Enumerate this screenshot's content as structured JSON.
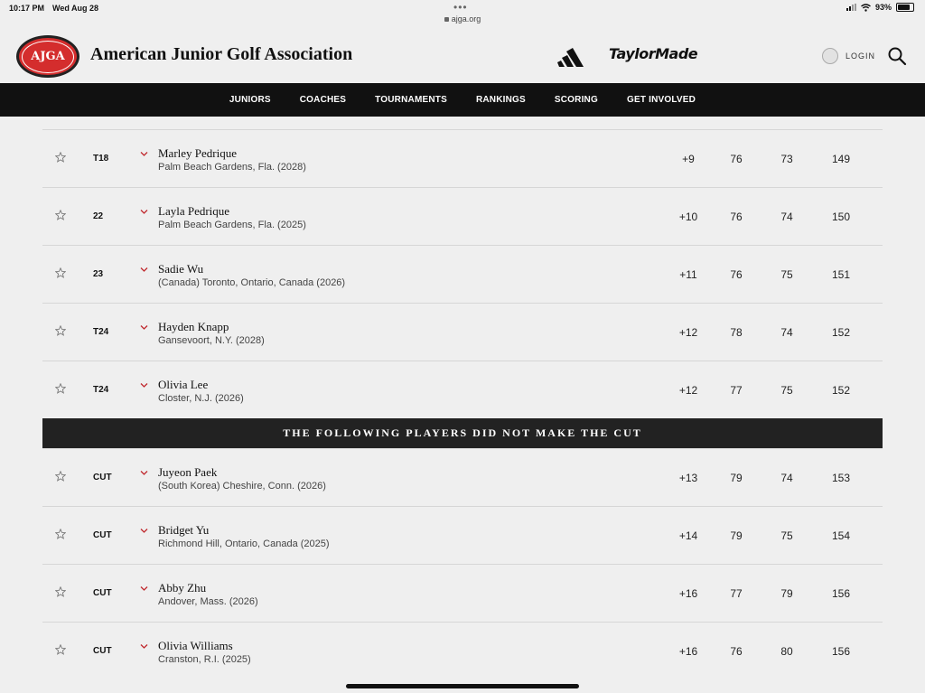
{
  "status": {
    "time": "10:17 PM",
    "date": "Wed Aug 28",
    "url": "ajga.org",
    "battery": "93%"
  },
  "header": {
    "logo_text": "AJGA",
    "title": "American Junior Golf Association",
    "sponsor_adidas": "adidas-logo",
    "sponsor_taylormade": "TaylorMade",
    "login_label": "LOGIN"
  },
  "nav": {
    "items": [
      "JUNIORS",
      "COACHES",
      "TOURNAMENTS",
      "RANKINGS",
      "SCORING",
      "GET INVOLVED"
    ]
  },
  "leaderboard": {
    "made_cut": [
      {
        "pos": "T18",
        "name": "Marley Pedrique",
        "location": "Palm Beach Gardens, Fla. (2028)",
        "to_par": "+9",
        "r1": "76",
        "r2": "73",
        "total": "149"
      },
      {
        "pos": "22",
        "name": "Layla Pedrique",
        "location": "Palm Beach Gardens, Fla. (2025)",
        "to_par": "+10",
        "r1": "76",
        "r2": "74",
        "total": "150"
      },
      {
        "pos": "23",
        "name": "Sadie Wu",
        "location": "(Canada) Toronto, Ontario, Canada (2026)",
        "to_par": "+11",
        "r1": "76",
        "r2": "75",
        "total": "151"
      },
      {
        "pos": "T24",
        "name": "Hayden Knapp",
        "location": "Gansevoort, N.Y. (2028)",
        "to_par": "+12",
        "r1": "78",
        "r2": "74",
        "total": "152"
      },
      {
        "pos": "T24",
        "name": "Olivia Lee",
        "location": "Closter, N.J. (2026)",
        "to_par": "+12",
        "r1": "77",
        "r2": "75",
        "total": "152"
      }
    ],
    "cut_banner": "THE FOLLOWING PLAYERS DID NOT MAKE THE CUT",
    "missed_cut": [
      {
        "pos": "CUT",
        "name": "Juyeon Paek",
        "location": "(South Korea) Cheshire, Conn. (2026)",
        "to_par": "+13",
        "r1": "79",
        "r2": "74",
        "total": "153"
      },
      {
        "pos": "CUT",
        "name": "Bridget Yu",
        "location": "Richmond Hill, Ontario, Canada (2025)",
        "to_par": "+14",
        "r1": "79",
        "r2": "75",
        "total": "154"
      },
      {
        "pos": "CUT",
        "name": "Abby Zhu",
        "location": "Andover, Mass. (2026)",
        "to_par": "+16",
        "r1": "77",
        "r2": "79",
        "total": "156"
      },
      {
        "pos": "CUT",
        "name": "Olivia Williams",
        "location": "Cranston, R.I. (2025)",
        "to_par": "+16",
        "r1": "76",
        "r2": "80",
        "total": "156"
      }
    ]
  },
  "colors": {
    "brand_red": "#d42d2d",
    "nav_bg": "#111111",
    "chevron": "#c0282d"
  }
}
